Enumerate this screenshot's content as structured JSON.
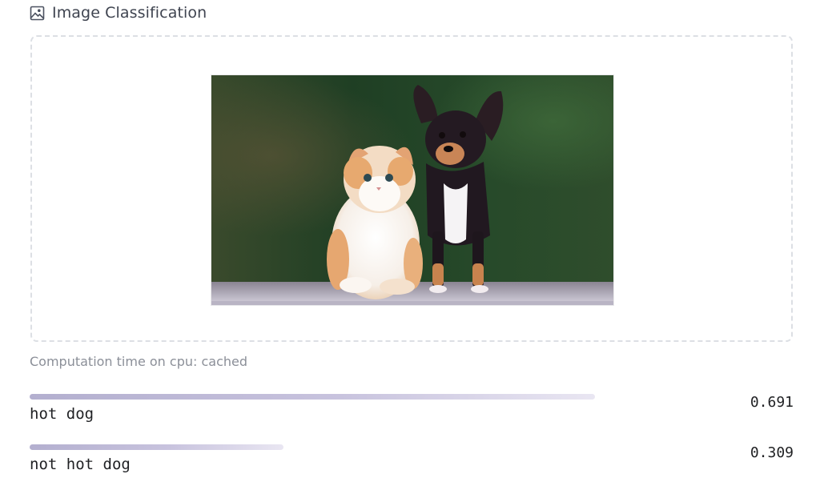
{
  "header": {
    "title": "Image Classification",
    "icon": "image-icon"
  },
  "input": {
    "image_alt": "cat and dog",
    "image_subject": "kitten-and-chihuahua-photo"
  },
  "output": {
    "computation_time": "Computation time on cpu: cached",
    "results": [
      {
        "label": "hot dog",
        "score": "0.691",
        "confidence": 0.691
      },
      {
        "label": "not hot dog",
        "score": "0.309",
        "confidence": 0.309
      }
    ]
  },
  "colors": {
    "bar_start": "#b3afcf",
    "bar_end": "#e9e6f2",
    "border": "#dcdfe4",
    "muted_text": "#8b8f98"
  }
}
